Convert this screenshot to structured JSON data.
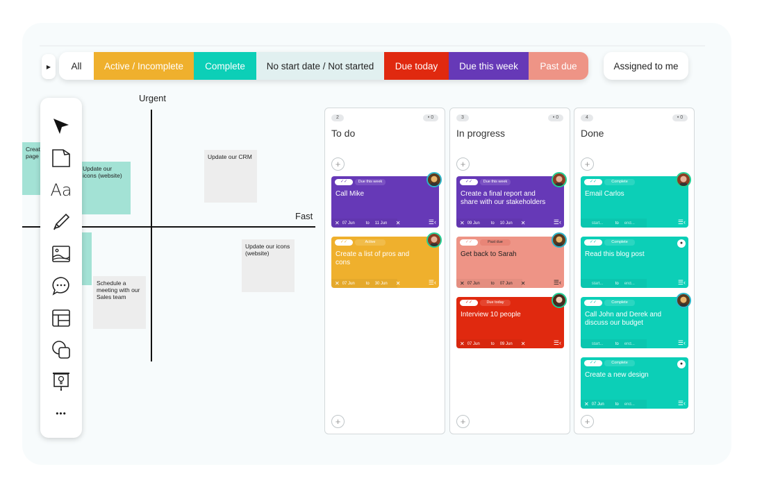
{
  "filters": {
    "toggle_icon": "caret-right-icon",
    "items": [
      {
        "label": "All",
        "bg": "#ffffff",
        "fg": "#222222"
      },
      {
        "label": "Active / Incomplete",
        "bg": "#efb02d",
        "fg": "#ffffff"
      },
      {
        "label": "Complete",
        "bg": "#0ccfb7",
        "fg": "#ffffff"
      },
      {
        "label": "No start date / Not started",
        "bg": "#e1f0f0",
        "fg": "#222222"
      },
      {
        "label": "Due today",
        "bg": "#e0290f",
        "fg": "#ffffff"
      },
      {
        "label": "Due this week",
        "bg": "#6639b7",
        "fg": "#ffffff"
      },
      {
        "label": "Past due",
        "bg": "#ee9486",
        "fg": "#ffffff"
      }
    ],
    "assigned_to_me": "Assigned to me"
  },
  "toolbar": {
    "tools": [
      "select-arrow-icon",
      "sticky-note-icon",
      "text-icon",
      "pencil-icon",
      "image-icon",
      "comment-icon",
      "template-icon",
      "shapes-icon",
      "presentation-icon",
      "more-icon"
    ],
    "text_glyph": "Aa",
    "more_glyph": "•••"
  },
  "matrix": {
    "y_axis_label": "Urgent",
    "x_axis_label": "Fast",
    "stickies": [
      {
        "text": "Create a landing page",
        "visible_text": "Create page",
        "color": "green"
      },
      {
        "text": "Update our icons (website)",
        "color": "green"
      },
      {
        "text": "Update our CRM",
        "color": "gray"
      },
      {
        "text": "Update our icons (website)",
        "color": "gray"
      },
      {
        "text": "Schedule a meeting with our Sales team",
        "color": "gray"
      },
      {
        "text": "",
        "color": "green"
      }
    ]
  },
  "columns": [
    {
      "title": "To do",
      "count": "2",
      "dot_count": "• 0",
      "add": "+",
      "cards": [
        {
          "title": "Call Mike",
          "status": "Due this week",
          "bg": "#6639b7",
          "pill": "#7b52c3",
          "start": "07 Jun",
          "to": "to",
          "end": "11 Jun",
          "has_start_x": true,
          "has_end_x": true,
          "avatar": "man-glasses"
        },
        {
          "title": "Create a list of pros and cons",
          "status": "Active",
          "bg": "#efb02d",
          "pill": "#f1bc4a",
          "start": "07 Jun",
          "to": "to",
          "end": "30 Jun",
          "has_start_x": true,
          "has_end_x": true,
          "avatar": "woman-red-hair"
        }
      ]
    },
    {
      "title": "In progress",
      "count": "3",
      "dot_count": "• 0",
      "add": "+",
      "cards": [
        {
          "title": "Create a final report and share with our stakeholders",
          "status": "Due this week",
          "bg": "#6639b7",
          "pill": "#7b52c3",
          "start": "09 Jun",
          "to": "to",
          "end": "10 Jun",
          "has_start_x": true,
          "has_end_x": true,
          "avatar": "woman-red-hair"
        },
        {
          "title": "Get back to Sarah",
          "status": "Past due",
          "bg": "#ee9486",
          "pill": "#e88577",
          "start": "07 Jun",
          "to": "to",
          "end": "07 Jun",
          "has_start_x": true,
          "has_end_x": true,
          "avatar": "man-glasses",
          "dark_text": true
        },
        {
          "title": "Interview 10 people",
          "status": "Due today",
          "bg": "#e0290f",
          "pill": "#e5452e",
          "start": "07 Jun",
          "to": "to",
          "end": "09 Jun",
          "has_start_x": true,
          "has_end_x": true,
          "avatar": "woman-brown-hair"
        }
      ]
    },
    {
      "title": "Done",
      "count": "4",
      "dot_count": "• 0",
      "add": "+",
      "cards": [
        {
          "title": "Email Carlos",
          "status": "Complete",
          "bg": "#0ccfb7",
          "pill": "#2bd6c1",
          "start": "start...",
          "to": "to",
          "end": "end...",
          "has_start_x": false,
          "has_end_x": false,
          "avatar": "woman-red-hair"
        },
        {
          "title": "Read this blog post",
          "status": "Complete",
          "bg": "#0ccfb7",
          "pill": "#2bd6c1",
          "start": "start...",
          "to": "to",
          "end": "end...",
          "has_start_x": false,
          "has_end_x": false,
          "avatar": "add-person"
        },
        {
          "title": "Call John and Derek  and discuss our budget",
          "status": "Complete",
          "bg": "#0ccfb7",
          "pill": "#2bd6c1",
          "start": "start...",
          "to": "to",
          "end": "end...",
          "has_start_x": false,
          "has_end_x": false,
          "avatar": "man-glasses"
        },
        {
          "title": "Create a new design",
          "status": "Complete",
          "bg": "#0ccfb7",
          "pill": "#2bd6c1",
          "start": "07 Jun",
          "to": "to",
          "end": "end...",
          "has_start_x": true,
          "has_end_x": false,
          "avatar": "add-person"
        }
      ]
    }
  ],
  "glyphs": {
    "check": "✓✓",
    "x": "✕",
    "menu": "☰‹",
    "add_person": "+●"
  }
}
